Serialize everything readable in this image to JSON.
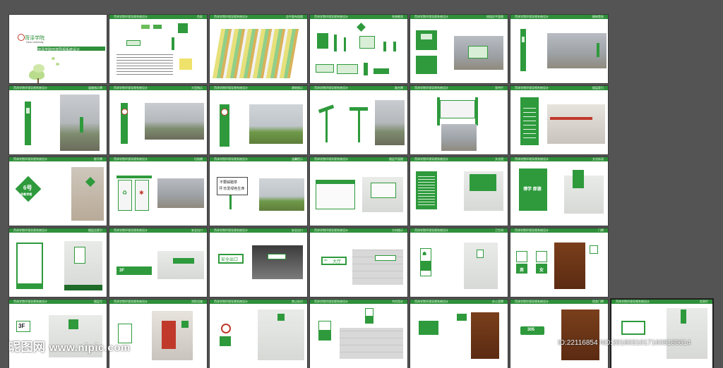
{
  "pages": [
    {
      "title": "菏泽学院环境导视系统设计",
      "tag": "封面"
    },
    {
      "title": "菏泽学院环境导视系统设计",
      "tag": "色彩"
    },
    {
      "title": "菏泽学院环境导视系统设计",
      "tag": "总平面布局图"
    },
    {
      "title": "菏泽学院环境导视系统设计",
      "tag": "系统概览"
    },
    {
      "title": "菏泽学院环境导视系统设计",
      "tag": "校园总平面图"
    },
    {
      "title": "菏泽学院环境导视系统设计",
      "tag": "精神堡垒"
    },
    {
      "title": "菏泽学院环境导视系统设计",
      "tag": "道路指示牌"
    },
    {
      "title": "菏泽学院环境导视系统设计",
      "tag": "大型指示"
    },
    {
      "title": "菏泽学院环境导视系统设计",
      "tag": "建筑指示"
    },
    {
      "title": "菏泽学院环境导视系统设计",
      "tag": "路名牌"
    },
    {
      "title": "菏泽学院环境导视系统设计",
      "tag": "宣传栏"
    },
    {
      "title": "菏泽学院环境导视系统设计",
      "tag": "楼层索引"
    },
    {
      "title": "菏泽学院环境导视系统设计",
      "tag": "楼号牌"
    },
    {
      "title": "菏泽学院环境导视系统设计",
      "tag": "垃圾桶"
    },
    {
      "title": "菏泽学院环境导视系统设计",
      "tag": "温馨提示"
    },
    {
      "title": "菏泽学院环境导视系统设计",
      "tag": "楼层平面图"
    },
    {
      "title": "菏泽学院环境导视系统设计",
      "tag": "文化墙"
    },
    {
      "title": "菏泽学院环境导视系统设计",
      "tag": "文化标语"
    },
    {
      "title": "菏泽学院环境导视系统设计",
      "tag": "楼层总索引"
    },
    {
      "title": "菏泽学院环境导视系统设计",
      "tag": "安全出口"
    },
    {
      "title": "菏泽学院环境导视系统设计",
      "tag": "安全出口"
    },
    {
      "title": "菏泽学院环境导视系统设计",
      "tag": "方向指示"
    },
    {
      "title": "菏泽学院环境导视系统设计",
      "tag": "卫生间"
    },
    {
      "title": "菏泽学院环境导视系统设计",
      "tag": "门牌"
    },
    {
      "title": "菏泽学院环境导视系统设计",
      "tag": "楼层号"
    },
    {
      "title": "菏泽学院环境导视系统设计",
      "tag": "消防设施"
    },
    {
      "title": "菏泽学院环境导视系统设计",
      "tag": "禁止标识"
    },
    {
      "title": "菏泽学院环境导视系统设计",
      "tag": "节约用水"
    },
    {
      "title": "菏泽学院环境导视系统设计",
      "tag": "办公室牌"
    },
    {
      "title": "菏泽学院环境导视系统设计",
      "tag": "宿舍门牌"
    },
    {
      "title": "菏泽学院环境导视系统设计",
      "tag": "信息栏"
    }
  ],
  "cover": {
    "logo": "菏泽学院",
    "logo_sub": "Heze University",
    "subtitle": "菏泽学院环境导视系统设计"
  },
  "signs": {
    "no_smoking_text": "不要吸烟",
    "lawn_line1": "不要踩踏草",
    "lawn_line2": "坪 珍爱绿色生命",
    "exit_text": "安全出口",
    "exit_arrow_text": "安全出口",
    "hall_text": "大厅",
    "floor_3f": "3F",
    "floor_3f_small": "3F",
    "room_305": "305",
    "building_6": "6号",
    "building_label": "6号教学楼",
    "toilet_male": "男",
    "toilet_female": "女",
    "slogan": "博学 厚德",
    "water_text": "节约用水"
  },
  "watermark": {
    "brand": "昵图网",
    "url": "www.nipic.com",
    "image_id": "ID:22116854 NO:20160310171608186614"
  },
  "colors": {
    "accent": "#2e9a3c",
    "background": "#545454",
    "page": "#ffffff"
  }
}
